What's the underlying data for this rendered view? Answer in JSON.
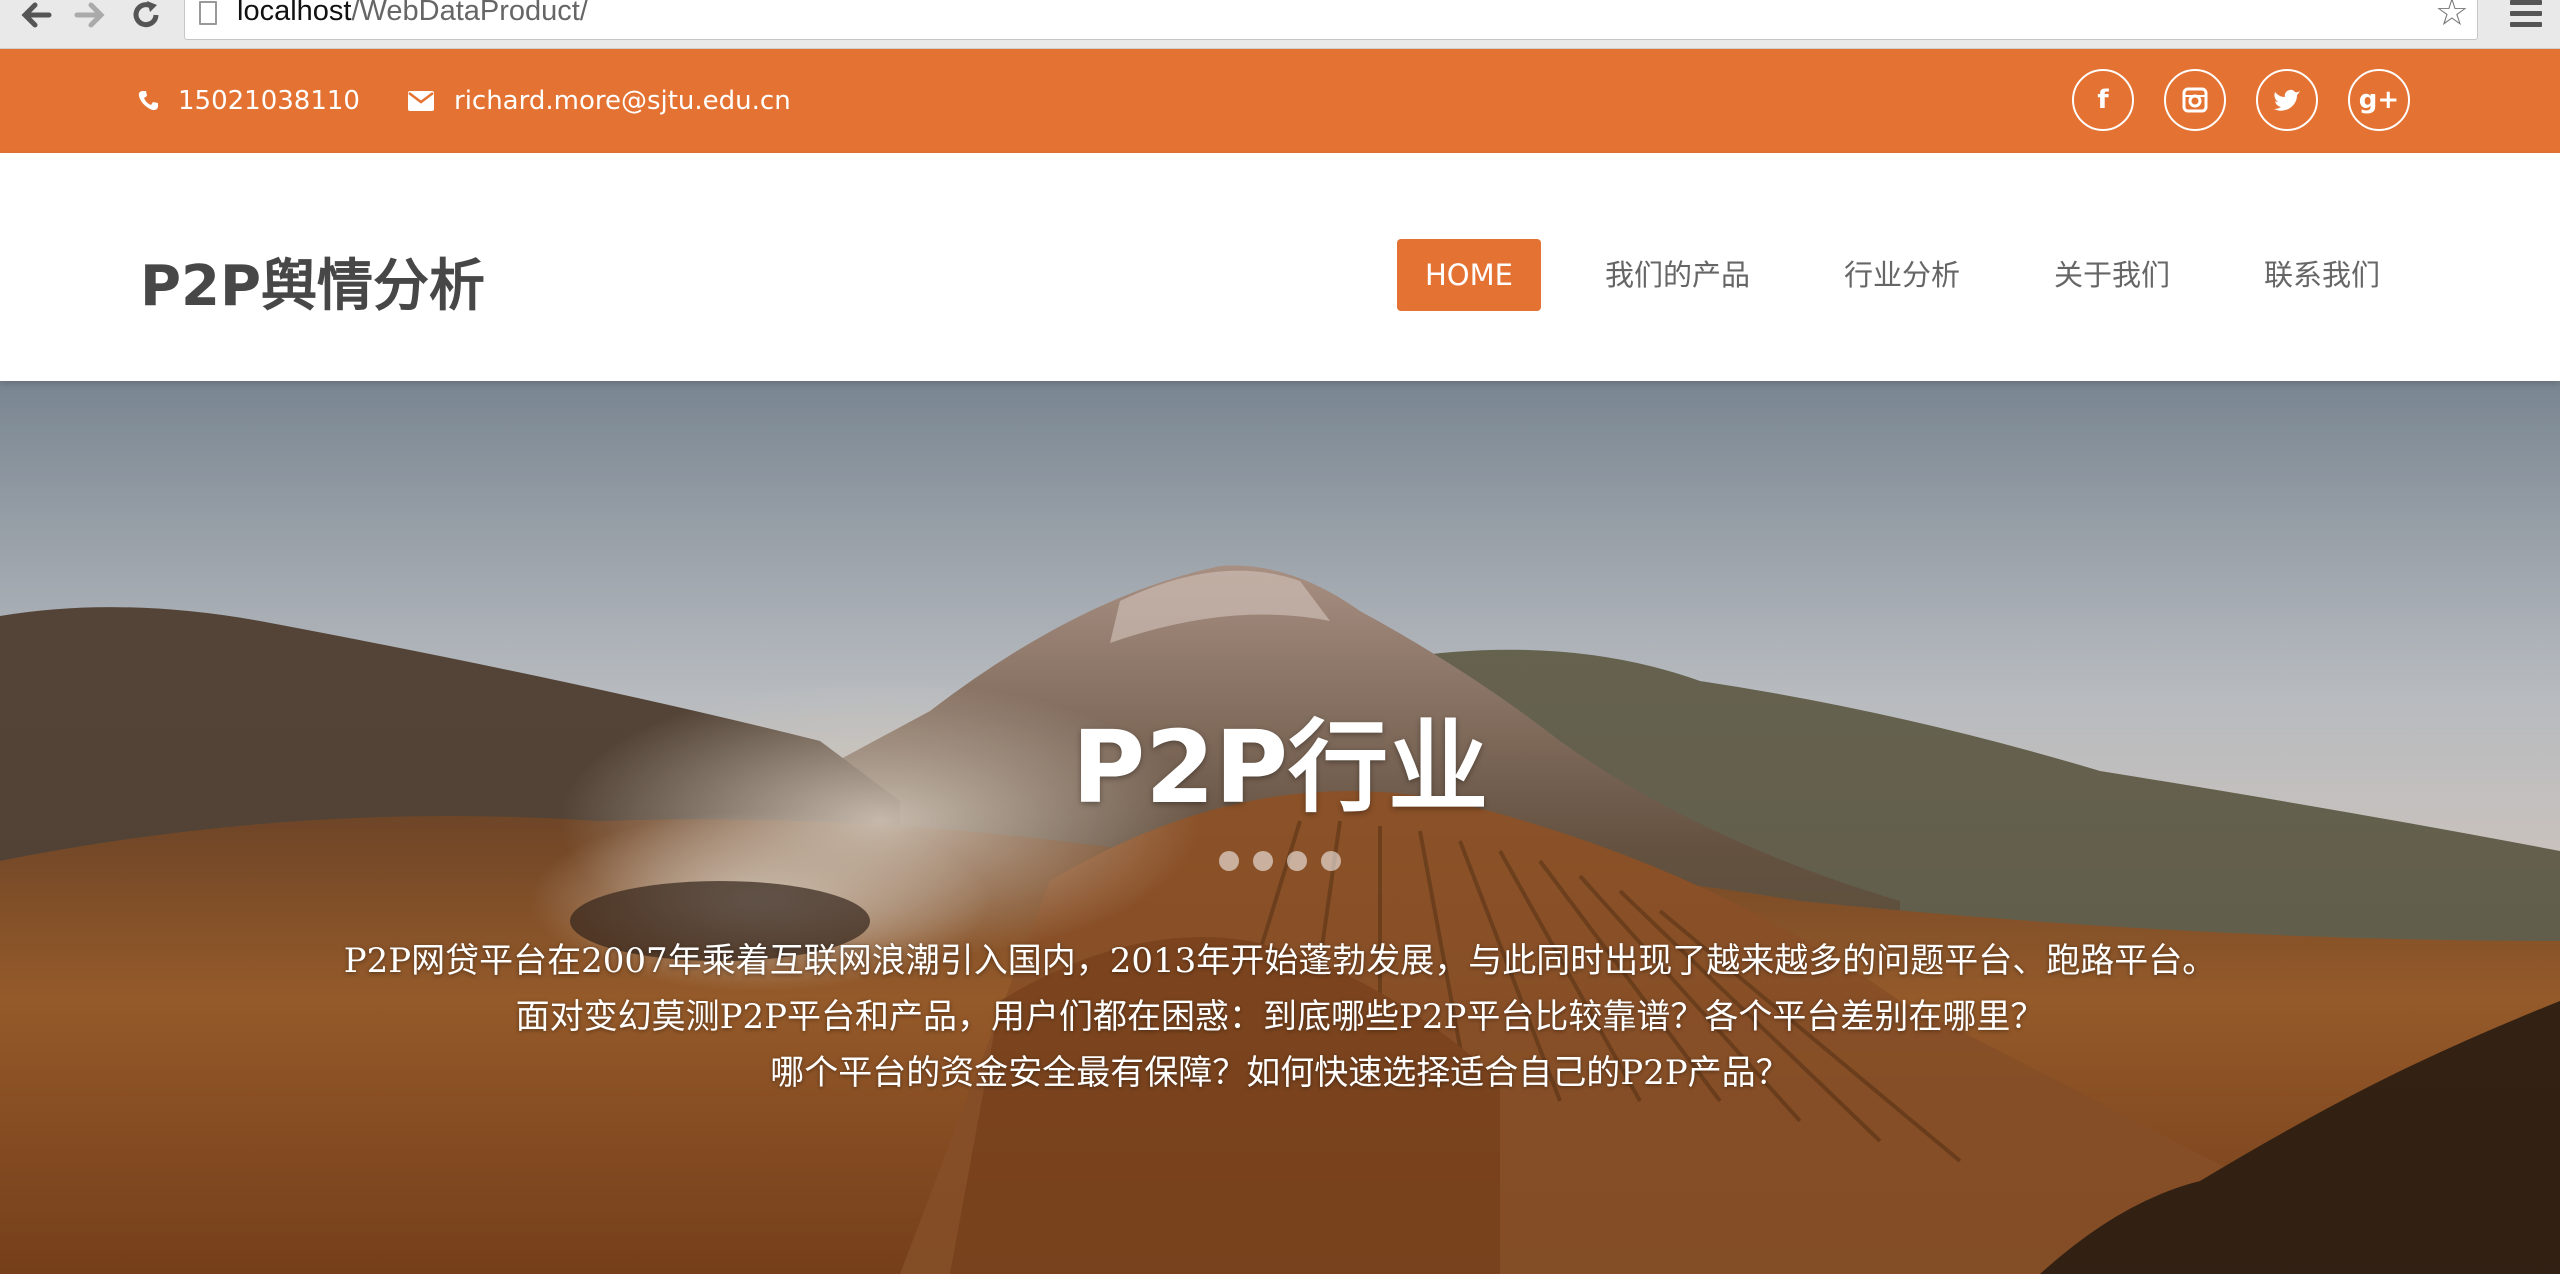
{
  "browser": {
    "url_host": "localhost",
    "url_path": "/WebDataProduct/",
    "icons": [
      "back-icon",
      "forward-icon",
      "reload-icon",
      "page-icon",
      "bookmark-star-icon",
      "menu-icon"
    ]
  },
  "topbar": {
    "phone": "15021038110",
    "email": "richard.more@sjtu.edu.cn",
    "socials": [
      {
        "name": "facebook-icon",
        "glyph": "f"
      },
      {
        "name": "instagram-icon",
        "glyph": ""
      },
      {
        "name": "twitter-icon",
        "glyph": ""
      },
      {
        "name": "google-plus-icon",
        "glyph": "g+"
      }
    ],
    "color": "#e47232"
  },
  "header": {
    "logo": "P2P舆情分析",
    "menu": [
      {
        "label": "HOME",
        "active": true
      },
      {
        "label": "我们的产品",
        "active": false
      },
      {
        "label": "行业分析",
        "active": false
      },
      {
        "label": "关于我们",
        "active": false
      },
      {
        "label": "联系我们",
        "active": false
      }
    ]
  },
  "hero": {
    "title": "P2P行业",
    "slide_count": 4,
    "lines": [
      "P2P网贷平台在2007年乘着互联网浪潮引入国内，2013年开始蓬勃发展，与此同时出现了越来越多的问题平台、跑路平台。",
      "面对变幻莫测P2P平台和产品，用户们都在困惑：到底哪些P2P平台比较靠谱？各个平台差别在哪里？",
      "哪个平台的资金安全最有保障？如何快速选择适合自己的P2P产品？"
    ]
  }
}
